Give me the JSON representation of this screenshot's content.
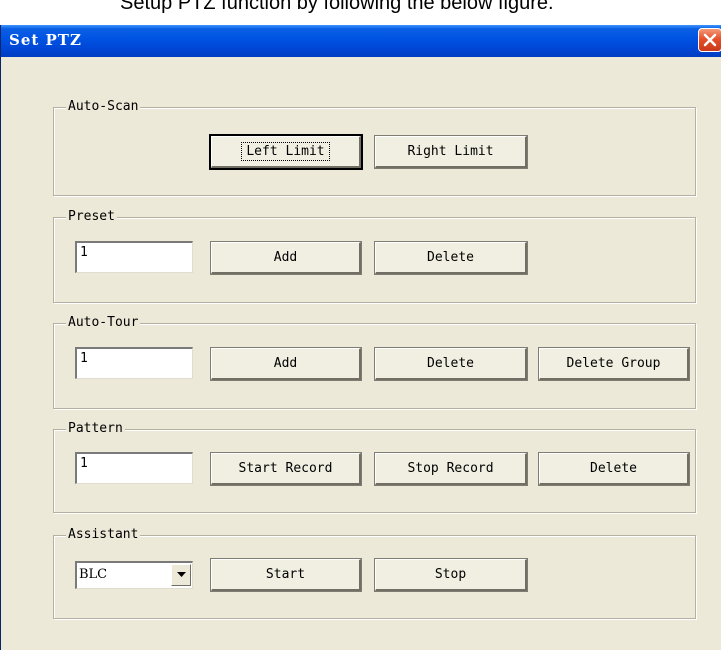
{
  "caption": "Setup PTZ function by following the below figure.",
  "window": {
    "title": "Set PTZ"
  },
  "auto_scan": {
    "label": "Auto-Scan",
    "left_limit": "Left Limit",
    "right_limit": "Right Limit"
  },
  "preset": {
    "label": "Preset",
    "value": "1",
    "add": "Add",
    "delete": "Delete"
  },
  "auto_tour": {
    "label": "Auto-Tour",
    "value": "1",
    "add": "Add",
    "delete": "Delete",
    "delete_group": "Delete Group"
  },
  "pattern": {
    "label": "Pattern",
    "value": "1",
    "start_record": "Start Record",
    "stop_record": "Stop Record",
    "delete": "Delete"
  },
  "assistant": {
    "label": "Assistant",
    "selected": "BLC",
    "start": "Start",
    "stop": "Stop"
  },
  "icons": {
    "close": "close-icon",
    "dropdown": "chevron-down-icon"
  }
}
